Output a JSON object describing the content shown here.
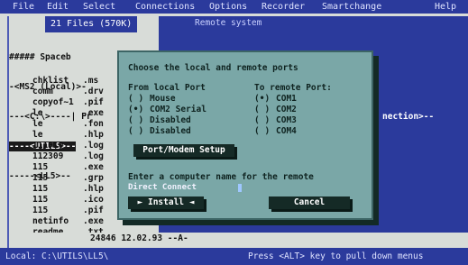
{
  "menubar": {
    "items": [
      "File",
      "Edit",
      "Select",
      "Connections",
      "Options",
      "Recorder",
      "Smartchange"
    ],
    "help": "Help"
  },
  "panel": {
    "title": "21 Files (570K)",
    "tree": [
      "##### Spaceb",
      "-<MS2 (Local)>-",
      "---<C:\\>----| Fr",
      "----<UTILS>--",
      "-----<LL5>--"
    ],
    "files": [
      {
        "name": "chklist",
        "ext": ".ms"
      },
      {
        "name": "comm",
        "ext": ".drv"
      },
      {
        "name": "copyof~1",
        "ext": ".pif"
      },
      {
        "name": "le",
        "ext": ".exe"
      },
      {
        "name": "le",
        "ext": ".fon"
      },
      {
        "name": "le",
        "ext": ".hlp"
      },
      {
        "name": "111910",
        "ext": ".log"
      },
      {
        "name": "112309",
        "ext": ".log"
      },
      {
        "name": "115",
        "ext": ".exe"
      },
      {
        "name": "115",
        "ext": ".grp"
      },
      {
        "name": "115",
        "ext": ".hlp"
      },
      {
        "name": "115",
        "ext": ".ico"
      },
      {
        "name": "115",
        "ext": ".pif"
      },
      {
        "name": "netinfo",
        "ext": ".exe"
      },
      {
        "name": "readme",
        "ext": ".txt"
      }
    ],
    "status_line": "24846  12.02.93  --A-"
  },
  "right_panel": {
    "title": "Remote system",
    "text": "nection>--"
  },
  "dialog": {
    "title": "Choose the local and remote ports",
    "from_header": "From local Port",
    "to_header": "To remote Port:",
    "local_ports": [
      {
        "radio": "( )",
        "label": "Mouse"
      },
      {
        "radio": "(•)",
        "label": "COM2 Serial"
      },
      {
        "radio": "( )",
        "label": "Disabled"
      },
      {
        "radio": "( )",
        "label": "Disabled"
      }
    ],
    "remote_ports": [
      {
        "radio": "(•)",
        "label": "COM1"
      },
      {
        "radio": "( )",
        "label": "COM2"
      },
      {
        "radio": "( )",
        "label": "COM3"
      },
      {
        "radio": "( )",
        "label": "COM4"
      }
    ],
    "setup_button": "Port/Modem Setup",
    "prompt": "Enter a computer name for the remote",
    "input_value": "Direct Connect",
    "install_button": "► Install ◄",
    "cancel_button": "Cancel"
  },
  "bottom_bar": {
    "left": "Local: C:\\UTILS\\LL5\\",
    "hint": "Press <ALT> key to pull down menus"
  },
  "colors": {
    "menubar_bg": "#2b3a9c",
    "dialog_bg": "#7aa7a7",
    "panel_bg": "#d8dcd8"
  }
}
